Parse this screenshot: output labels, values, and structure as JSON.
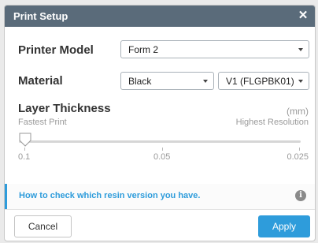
{
  "dialog": {
    "title": "Print Setup",
    "close_label": "✕"
  },
  "printer_model": {
    "label": "Printer Model",
    "selected": "Form 2"
  },
  "material": {
    "label": "Material",
    "selected": "Black",
    "version_selected": "V1 (FLGPBK01)"
  },
  "layer_thickness": {
    "label": "Layer Thickness",
    "unit": "(mm)",
    "left_hint": "Fastest Print",
    "right_hint": "Highest Resolution",
    "ticks": [
      "0.1",
      "0.05",
      "0.025"
    ],
    "value": "0.1"
  },
  "info": {
    "link_text": "How to check which resin version you have.",
    "icon": "info-icon"
  },
  "footer": {
    "cancel_label": "Cancel",
    "apply_label": "Apply"
  },
  "colors": {
    "titlebar": "#5a6b7a",
    "accent": "#2e9cdb"
  }
}
